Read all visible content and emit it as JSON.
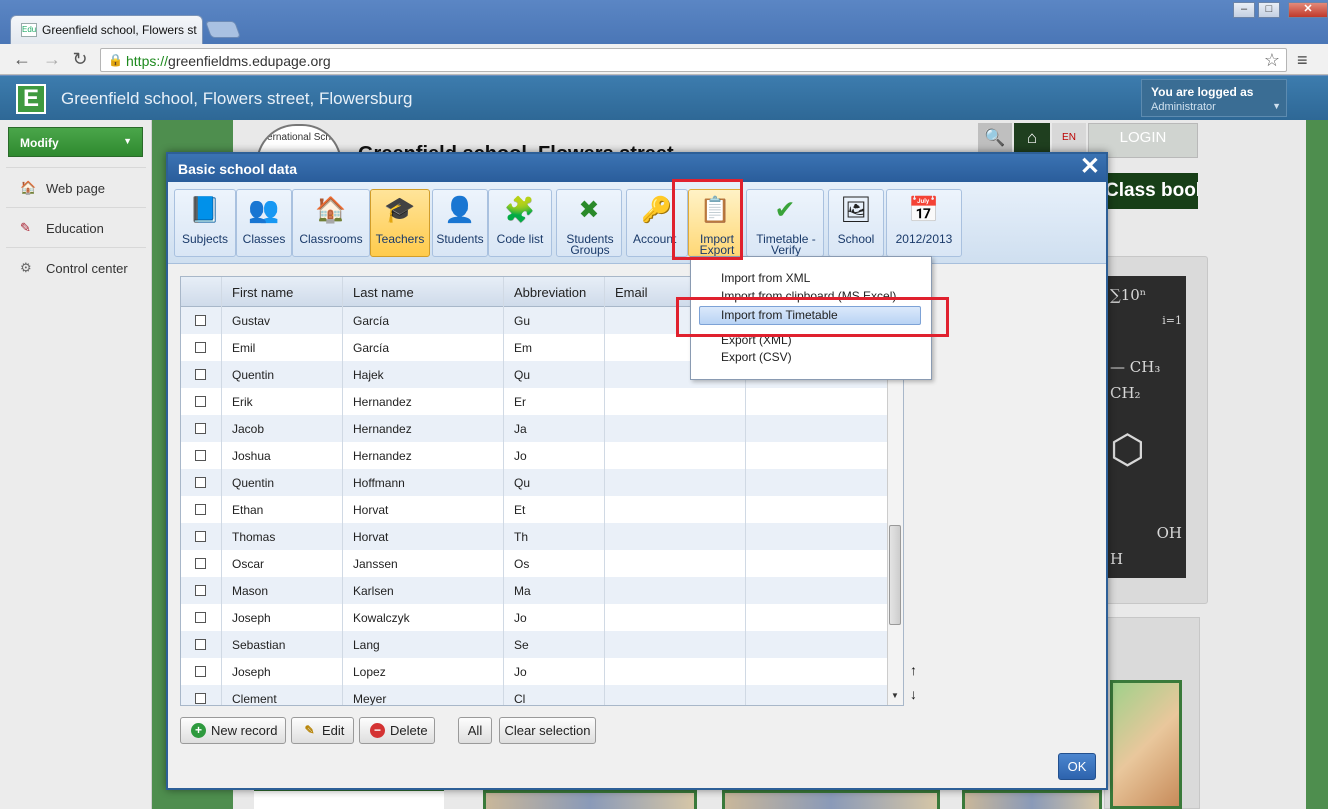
{
  "browser": {
    "tab_title": "Greenfield school, Flowers st",
    "tab_favicon": "Edu",
    "url_prefix": "https://",
    "url_host": "greenfieldms.edupage.org",
    "window_buttons": [
      "–",
      "□",
      "✕"
    ]
  },
  "site": {
    "title": "Greenfield school, Flowers street, Flowersburg",
    "logged_as": "You are logged as",
    "role": "Administrator",
    "school_name": "Greenfield school, Flowers street",
    "emblem_text": "ernational Sch",
    "login": "LOGIN",
    "class_book": "Class book",
    "flag_label": "EN"
  },
  "sidebar": {
    "modify": "Modify",
    "items": [
      {
        "label": "Web page",
        "icon": "globe-icon"
      },
      {
        "label": "Education",
        "icon": "education-icon"
      },
      {
        "label": "Control center",
        "icon": "gear-icon"
      }
    ]
  },
  "dialog": {
    "title": "Basic school data",
    "toolbar": [
      {
        "label": "Subjects",
        "icon": "book-icon",
        "glyph": "📘"
      },
      {
        "label": "Classes",
        "icon": "classes-icon",
        "glyph": "👥"
      },
      {
        "label": "Classrooms",
        "icon": "classroom-icon",
        "glyph": "🏠"
      },
      {
        "label": "Teachers",
        "icon": "teacher-icon",
        "glyph": "🎓"
      },
      {
        "label": "Students",
        "icon": "student-icon",
        "glyph": "👤"
      },
      {
        "label": "Code list",
        "icon": "code-list-icon",
        "glyph": "🧩"
      },
      {
        "label": "Students Groups",
        "icon": "groups-icon",
        "glyph": "✖"
      },
      {
        "label": "Account",
        "icon": "account-icon",
        "glyph": "🔑"
      },
      {
        "label": "Import Export",
        "icon": "import-export-icon",
        "glyph": "📋"
      },
      {
        "label": "Timetable - Verify",
        "icon": "checkmark-icon",
        "glyph": "✔"
      },
      {
        "label": "School",
        "icon": "chalkboard-icon",
        "glyph": "🖼"
      },
      {
        "label": "2012/2013",
        "icon": "calendar-icon",
        "glyph": "📅"
      }
    ],
    "columns": [
      "First name",
      "Last name",
      "Abbreviation",
      "Email"
    ],
    "rows": [
      [
        "Gustav",
        "García",
        "Gu"
      ],
      [
        "Emil",
        "García",
        "Em"
      ],
      [
        "Quentin",
        "Hajek",
        "Qu"
      ],
      [
        "Erik",
        "Hernandez",
        "Er"
      ],
      [
        "Jacob",
        "Hernandez",
        "Ja"
      ],
      [
        "Joshua",
        "Hernandez",
        "Jo"
      ],
      [
        "Quentin",
        "Hoffmann",
        "Qu"
      ],
      [
        "Ethan",
        "Horvat",
        "Et"
      ],
      [
        "Thomas",
        "Horvat",
        "Th"
      ],
      [
        "Oscar",
        "Janssen",
        "Os"
      ],
      [
        "Mason",
        "Karlsen",
        "Ma"
      ],
      [
        "Joseph",
        "Kowalczyk",
        "Jo"
      ],
      [
        "Sebastian",
        "Lang",
        "Se"
      ],
      [
        "Joseph",
        "Lopez",
        "Jo"
      ],
      [
        "Clement",
        "Meyer",
        "Cl"
      ]
    ],
    "buttons": {
      "new_record": "New record",
      "edit": "Edit",
      "delete": "Delete",
      "all": "All",
      "clear_selection": "Clear selection",
      "ok": "OK"
    },
    "import_menu": [
      "Import from XML",
      "Import from clipboard (MS Excel)",
      "Import from Timetable",
      "Export (XML)",
      "Export (CSV)"
    ]
  },
  "chalkboard": [
    "∑10ⁿ",
    "i=1",
    "— CH₃",
    "CH₂",
    "⬡",
    "OH",
    "H"
  ]
}
